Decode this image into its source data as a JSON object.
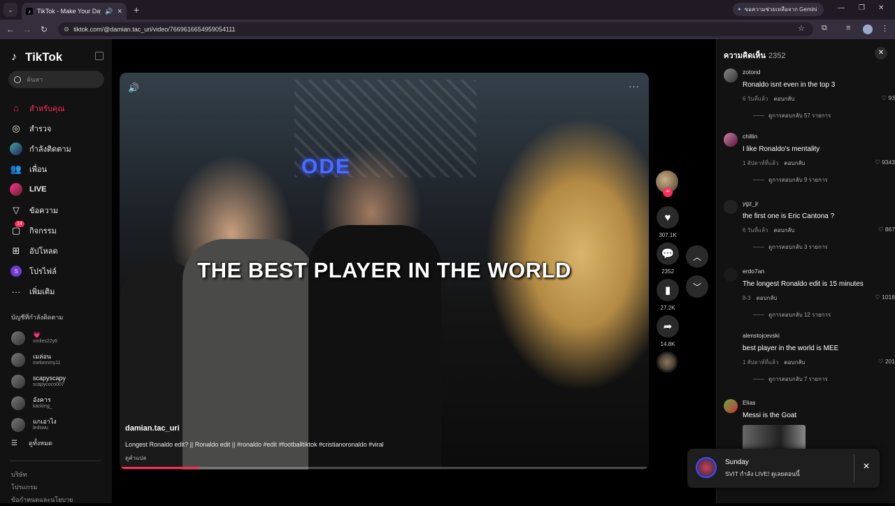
{
  "browser": {
    "tab_title": "TikTok - Make Your Day",
    "url": "tiktok.com/@damian.tac_uri/video/7669616654959054111",
    "gemini_label": "ขอความช่วยเหลือจาก Gemini"
  },
  "sidebar": {
    "logo": "TikTok",
    "search_placeholder": "ค้นหา",
    "nav": [
      {
        "label": "สำหรับคุณ",
        "icon": "home-icon"
      },
      {
        "label": "สำรวจ",
        "icon": "compass-icon"
      },
      {
        "label": "กำลังติดตาม",
        "icon": "following-avatar-icon"
      },
      {
        "label": "เพื่อน",
        "icon": "friends-icon"
      },
      {
        "label": "LIVE",
        "icon": "live-icon"
      },
      {
        "label": "ข้อความ",
        "icon": "send-icon"
      },
      {
        "label": "กิจกรรม",
        "icon": "activity-icon",
        "badge": "14"
      },
      {
        "label": "อัปโหลด",
        "icon": "upload-icon"
      },
      {
        "label": "โปรไฟล์",
        "icon": "profile-icon",
        "avatar_letter": "S"
      },
      {
        "label": "เพิ่มเติม",
        "icon": "more-icon"
      }
    ],
    "following_title": "บัญชีที่กำลังติดตาม",
    "following": [
      {
        "name": "💗",
        "handle": "smiles22y6"
      },
      {
        "name": "เมล่อน",
        "handle": "melonnmy11"
      },
      {
        "name": "scapyscapy",
        "handle": "scapycoco007"
      },
      {
        "name": "อังคาร",
        "handle": "kacking_"
      },
      {
        "name": "แกเอาไง",
        "handle": "ledswu"
      }
    ],
    "see_all": "ดูทั้งหมด",
    "footer": [
      "บริษัท",
      "โปรแกรม",
      "ข้อกำหนดและนโยบาย"
    ]
  },
  "video": {
    "overlay_text": "THE BEST PLAYER IN THE WORLD",
    "sign_text": "ODE",
    "author": "damian.tac_uri",
    "caption": "Longest Ronaldo edit? || Ronaldo edit || #ronaldo #edit #footballtiktok #cristianoronaldo #viral",
    "translate": "ดูคำแปล",
    "progress": 0.15
  },
  "actions": {
    "likes": "307.1K",
    "comments": "2352",
    "saves": "27.2K",
    "shares": "14.8K"
  },
  "comments_panel": {
    "title": "ความคิดเห็น",
    "count": "2352",
    "items": [
      {
        "user": "zotond",
        "text": "Ronaldo isnt even in the top 3",
        "time": "6 วันที่แล้ว",
        "reply": "ตอบกลับ",
        "likes": "93",
        "replies": "ดูการตอบกลับ 57 รายการ"
      },
      {
        "user": "chillin",
        "text": "I like Ronaldo's mentality",
        "time": "1 สัปดาห์ที่แล้ว",
        "reply": "ตอบกลับ",
        "likes": "9343",
        "replies": "ดูการตอบกลับ 9 รายการ"
      },
      {
        "user": "ygz_jr",
        "text": "the first one is Eric Cantona ?",
        "time": "6 วันที่แล้ว",
        "reply": "ตอบกลับ",
        "likes": "867",
        "replies": "ดูการตอบกลับ 3 รายการ"
      },
      {
        "user": "erdo7an",
        "text": "The longest Ronaldo edit is 15 minutes",
        "time": "8-3",
        "reply": "ตอบกลับ",
        "likes": "1018",
        "replies": "ดูการตอบกลับ 12 รายการ"
      },
      {
        "user": "alenstojcevski",
        "text": "best player in the world is MEE",
        "time": "1 สัปดาห์ที่แล้ว",
        "reply": "ตอบกลับ",
        "likes": "201",
        "replies": "ดูการตอบกลับ 7 รายการ"
      },
      {
        "user": "Elias",
        "text": "Messi is the Goat"
      }
    ]
  },
  "toast": {
    "title": "Sunday",
    "text": "SVIT กำลัง LIVE! ดูเลยตอนนี้"
  }
}
